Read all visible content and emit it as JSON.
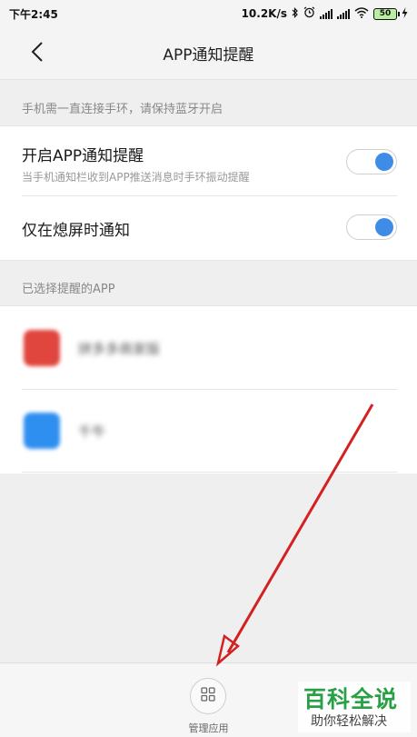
{
  "status_bar": {
    "time": "下午2:45",
    "net_speed": "10.2K/s",
    "battery": "50"
  },
  "header": {
    "title": "APP通知提醒",
    "back_icon": "chevron-left-icon"
  },
  "captions": {
    "bluetooth_hint": "手机需一直连接手环，请保持蓝牙开启",
    "selected_apps": "已选择提醒的APP"
  },
  "settings": {
    "app_notify": {
      "title": "开启APP通知提醒",
      "subtitle": "当手机通知栏收到APP推送消息时手环振动提醒",
      "enabled": true
    },
    "screen_off_only": {
      "title": "仅在熄屏时通知",
      "enabled": true
    }
  },
  "apps": [
    {
      "name": "拼多多商家版",
      "icon_color": "#e0453e"
    },
    {
      "name": "千牛",
      "icon_color": "#2f8ff0"
    }
  ],
  "bottom_bar": {
    "manage_label": "管理应用",
    "manage_icon": "grid-icon"
  },
  "watermark": {
    "main": "百科全说",
    "sub": "助你轻松解决"
  },
  "colors": {
    "toggle_on": "#3e8ce6",
    "annotation_arrow": "#d42020",
    "watermark_green": "#2aa046"
  }
}
